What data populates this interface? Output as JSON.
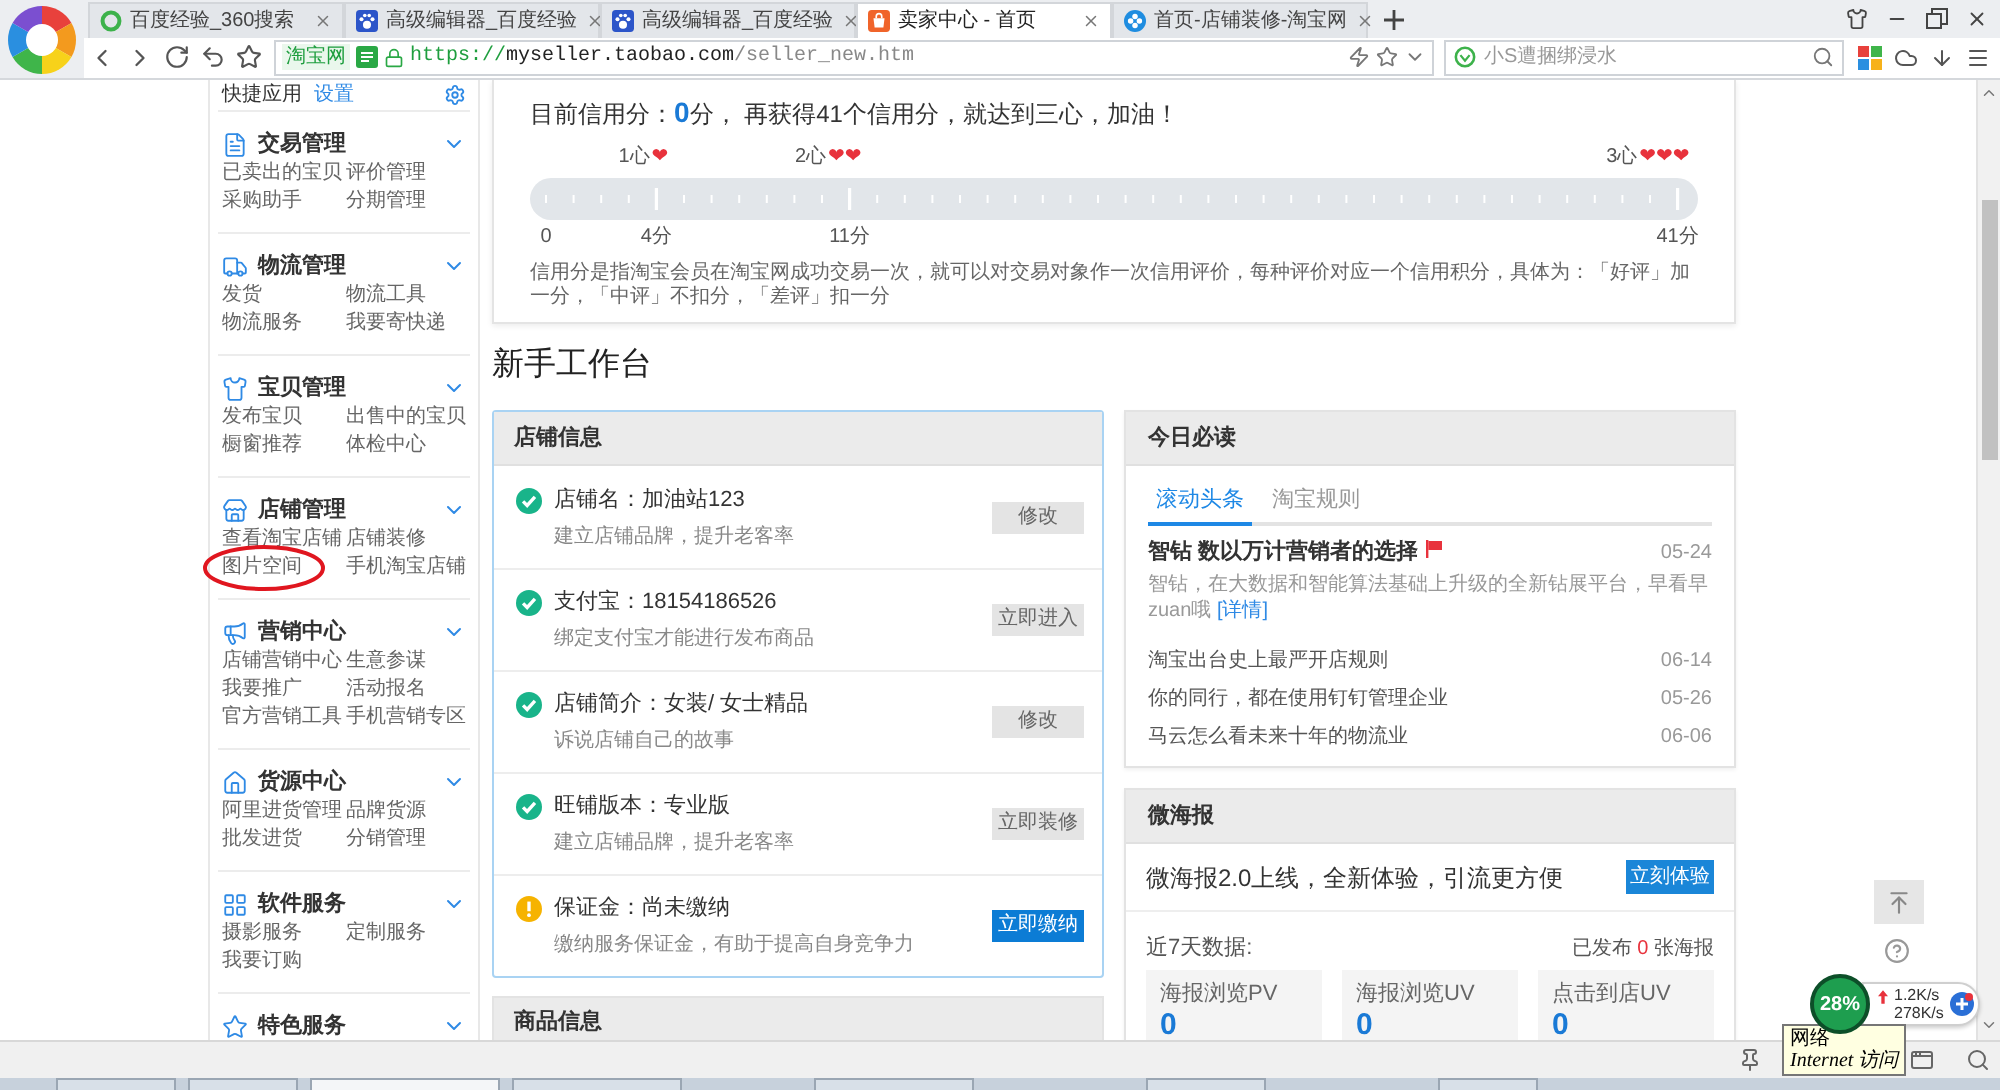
{
  "browser": {
    "tabs": [
      {
        "title": "百度经验_360搜索",
        "selected": false
      },
      {
        "title": "高级编辑器_百度经验",
        "selected": false
      },
      {
        "title": "高级编辑器_百度经验",
        "selected": false
      },
      {
        "title": "卖家中心 - 首页",
        "selected": true
      },
      {
        "title": "首页-店铺装修-淘宝网",
        "selected": false
      }
    ],
    "address": {
      "badge": "淘宝网",
      "scheme": "https://",
      "host": "myseller.taobao.com",
      "path": "/seller_new.htm"
    },
    "search": {
      "placeholder": "小S遭捆绑浸水"
    }
  },
  "sidebar": {
    "quick_apps": {
      "label": "快捷应用",
      "action": "设置"
    },
    "sections": [
      {
        "title": "交易管理",
        "links": [
          {
            "label": "已卖出的宝贝",
            "circled": false
          },
          {
            "label": "评价管理",
            "circled": false
          },
          {
            "label": "采购助手",
            "circled": false
          },
          {
            "label": "分期管理",
            "circled": false
          }
        ]
      },
      {
        "title": "物流管理",
        "links": [
          {
            "label": "发货",
            "circled": false
          },
          {
            "label": "物流工具",
            "circled": false
          },
          {
            "label": "物流服务",
            "circled": false
          },
          {
            "label": "我要寄快递",
            "circled": false
          }
        ]
      },
      {
        "title": "宝贝管理",
        "links": [
          {
            "label": "发布宝贝",
            "circled": false
          },
          {
            "label": "出售中的宝贝",
            "circled": false
          },
          {
            "label": "橱窗推荐",
            "circled": false
          },
          {
            "label": "体检中心",
            "circled": false
          }
        ]
      },
      {
        "title": "店铺管理",
        "links": [
          {
            "label": "查看淘宝店铺",
            "circled": false
          },
          {
            "label": "店铺装修",
            "circled": false
          },
          {
            "label": "图片空间",
            "circled": true
          },
          {
            "label": "手机淘宝店铺",
            "circled": false
          }
        ]
      },
      {
        "title": "营销中心",
        "links": [
          {
            "label": "店铺营销中心",
            "circled": false
          },
          {
            "label": "生意参谋",
            "circled": false
          },
          {
            "label": "我要推广",
            "circled": false
          },
          {
            "label": "活动报名",
            "circled": false
          },
          {
            "label": "官方营销工具",
            "circled": false
          },
          {
            "label": "手机营销专区",
            "circled": false
          }
        ]
      },
      {
        "title": "货源中心",
        "links": [
          {
            "label": "阿里进货管理",
            "circled": false
          },
          {
            "label": "品牌货源",
            "circled": false
          },
          {
            "label": "批发进货",
            "circled": false
          },
          {
            "label": "分销管理",
            "circled": false
          }
        ]
      },
      {
        "title": "软件服务",
        "links": [
          {
            "label": "摄影服务",
            "circled": false
          },
          {
            "label": "定制服务",
            "circled": false
          },
          {
            "label": "我要订购",
            "circled": false
          }
        ]
      },
      {
        "title": "特色服务"
      }
    ]
  },
  "credit": {
    "summary": "目前信用分：**0**分， 再获得41个信用分，就达到三心，加油！",
    "milestones": [
      {
        "label": "1心",
        "hearts": "❤"
      },
      {
        "label": "2心",
        "hearts": "❤❤"
      },
      {
        "label": "3心",
        "hearts": "❤❤❤"
      }
    ],
    "level": 0,
    "axis": [
      "0",
      "4分",
      "11分",
      "41分"
    ],
    "footnote": "信用分是指淘宝会员在淘宝网成功交易一次，就可以对交易对象作一次信用评价，每种评价对应一个信用积分，具体为：「好评」加一分，「中评」不扣分，「差评」扣一分"
  },
  "workbench": {
    "title": "新手工作台",
    "store_info": {
      "title": "店铺信息",
      "items": [
        {
          "title": "店铺名：加油站123",
          "note": "建立店铺品牌，提升老客率",
          "action": "修改",
          "kind": "done"
        },
        {
          "title": "支付宝：18154186526",
          "note": "绑定支付宝才能进行发布商品",
          "action": "立即进入",
          "kind": "done"
        },
        {
          "title": "店铺简介：女装/ 女士精品",
          "note": "诉说店铺自己的故事",
          "action": "修改",
          "kind": "done"
        },
        {
          "title": "旺铺版本：专业版",
          "note": "建立店铺品牌，提升老客率",
          "action": "立即装修",
          "kind": "done"
        },
        {
          "title": "保证金：尚未缴纳",
          "note": "缴纳服务保证金，有助于提高自身竞争力",
          "action": "立即缴纳",
          "kind": "pending"
        }
      ]
    },
    "goods_info": {
      "title": "商品信息"
    },
    "daily": {
      "title": "今日必读",
      "tabs": [
        {
          "label": "滚动头条",
          "selected": true
        },
        {
          "label": "淘宝规则",
          "selected": false
        }
      ],
      "headline": {
        "title": "智钻 数以万计营销者的选择",
        "date": "05-24",
        "summary": "智钻，在大数据和智能算法基础上升级的全新钻展平台，早看早zuan哦",
        "link": "[详情]"
      },
      "news": [
        {
          "title": "淘宝出台史上最严开店规则",
          "date": "06-14"
        },
        {
          "title": "你的同行，都在使用钉钉管理企业",
          "date": "05-26"
        },
        {
          "title": "马云怎么看未来十年的物流业",
          "date": "06-06"
        }
      ]
    },
    "poster": {
      "title": "微海报",
      "banner": "微海报2.0上线，全新体验，引流更方便",
      "button": "立刻体验",
      "period": "近7天数据:",
      "published": "已发布 **0** 张海报",
      "stats": [
        {
          "label": "海报浏览PV",
          "value": "0"
        },
        {
          "label": "海报浏览UV",
          "value": "0"
        },
        {
          "label": "点击到店UV",
          "value": "0"
        }
      ]
    }
  },
  "speed_widget": {
    "percent": "28%",
    "upload": "1.2K/s",
    "download": "278K/s"
  },
  "status_bar": {
    "tooltip": {
      "title": "网络",
      "text": "Internet 访问"
    }
  }
}
